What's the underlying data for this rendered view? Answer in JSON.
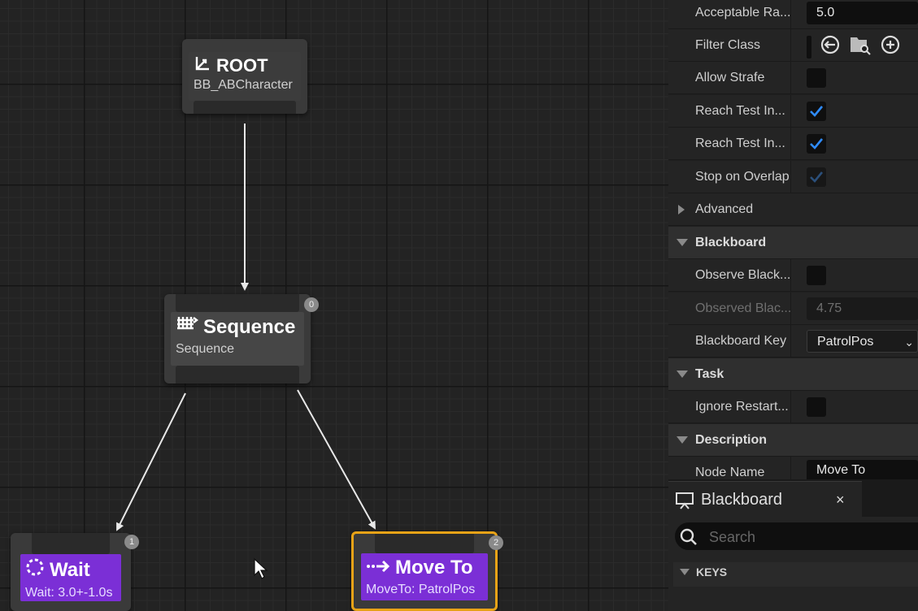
{
  "graph": {
    "nodes": {
      "root": {
        "title": "ROOT",
        "subtitle": "BB_ABCharacter"
      },
      "sequence": {
        "title": "Sequence",
        "subtitle": "Sequence",
        "index": "0"
      },
      "wait": {
        "title": "Wait",
        "subtitle": "Wait: 3.0+-1.0s",
        "index": "1",
        "color": "#7b2fd6"
      },
      "move_to": {
        "title": "Move To",
        "subtitle": "MoveTo: PatrolPos",
        "index": "2",
        "color": "#7b2fd6",
        "selected_outline": "#e8a317"
      }
    }
  },
  "details": {
    "rows": [
      {
        "label": "Acceptable Ra...",
        "value": "5.0"
      },
      {
        "label": "Filter Class",
        "icons": [
          "reset-arrow-icon",
          "browse-folder-icon",
          "add-circle-icon"
        ]
      },
      {
        "label": "Allow Strafe",
        "checked": false
      },
      {
        "label": "Reach Test In...",
        "checked": true
      },
      {
        "label": "Reach Test In...",
        "checked": true
      },
      {
        "label": "Stop on Overlap",
        "checked": true,
        "dimmed": true
      }
    ],
    "advanced_label": "Advanced",
    "blackboard_section": {
      "label": "Blackboard",
      "observe_label": "Observe Black...",
      "observe_checked": false,
      "observed_label": "Observed Blac...",
      "observed_value": "4.75",
      "key_label": "Blackboard Key",
      "key_value": "PatrolPos"
    },
    "task_section": {
      "label": "Task",
      "ignore_label": "Ignore Restart...",
      "ignore_checked": false
    },
    "description_section": {
      "label": "Description",
      "node_name_label": "Node Name",
      "node_name_value": "Move To"
    }
  },
  "blackboard_panel": {
    "tab_title": "Blackboard",
    "close": "×",
    "search_placeholder": "Search",
    "keys_label": "KEYS"
  },
  "colors": {
    "accent_check": "#2f8cff",
    "task_node": "#7b2fd6",
    "selection": "#e8a317"
  }
}
